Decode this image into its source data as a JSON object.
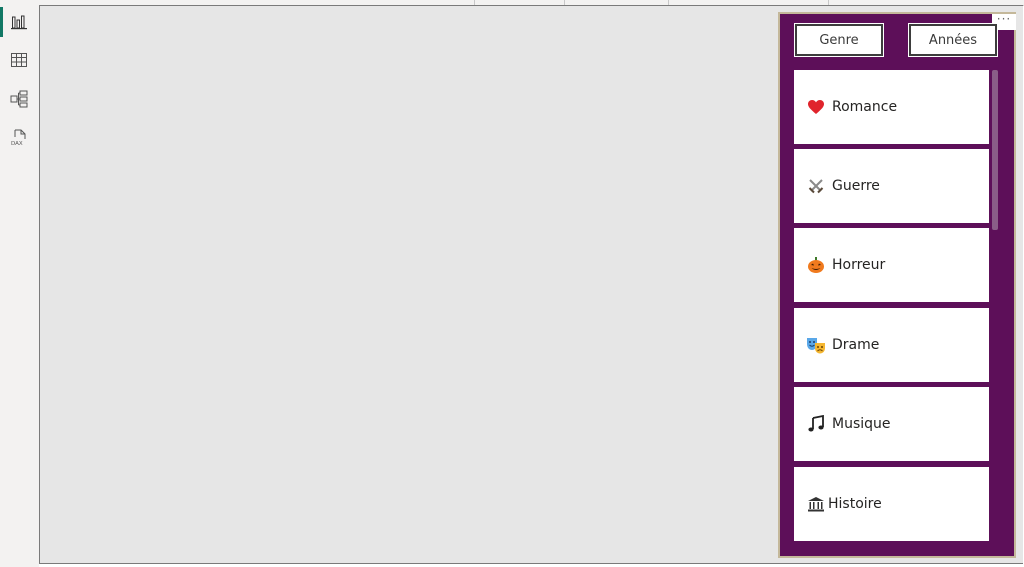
{
  "panel": {
    "tabs": [
      {
        "label": "Genre"
      },
      {
        "label": "Années"
      }
    ],
    "more_label": "···",
    "items": [
      {
        "label": "Romance",
        "icon": "heart-icon"
      },
      {
        "label": "Guerre",
        "icon": "crossed-swords-icon"
      },
      {
        "label": "Horreur",
        "icon": "pumpkin-icon"
      },
      {
        "label": "Drame",
        "icon": "theater-masks-icon"
      },
      {
        "label": "Musique",
        "icon": "music-notes-icon"
      },
      {
        "label": "Histoire",
        "icon": "monument-icon"
      }
    ]
  },
  "colors": {
    "panel_bg": "#5d0f59",
    "accent": "#117865",
    "canvas_bg": "#e6e6e6"
  }
}
